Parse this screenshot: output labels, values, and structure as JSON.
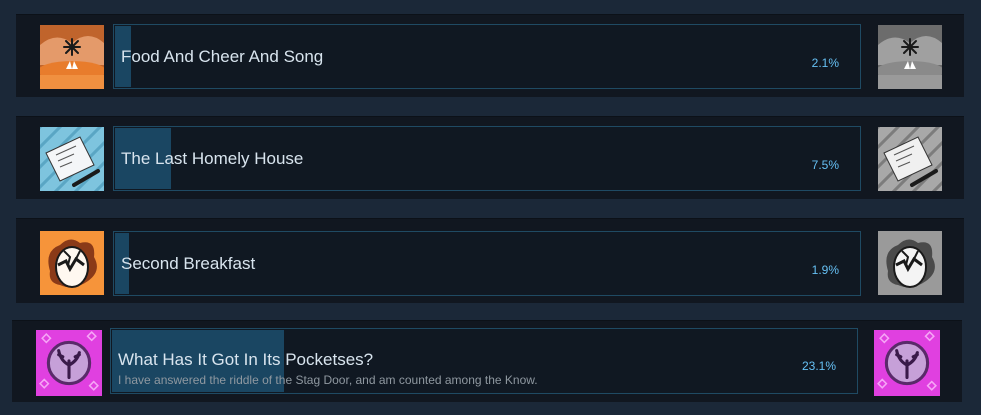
{
  "achievements": [
    {
      "name": "Food And Cheer And Song",
      "description": "",
      "percent_label": "2.1%",
      "percent": 2.1,
      "icon": "feast-plate-icon"
    },
    {
      "name": "The Last Homely House",
      "description": "",
      "percent_label": "7.5%",
      "percent": 7.5,
      "icon": "letter-and-pen-icon"
    },
    {
      "name": "Second Breakfast",
      "description": "",
      "percent_label": "1.9%",
      "percent": 1.9,
      "icon": "cracked-egg-icon"
    },
    {
      "name": "What Has It Got In Its Pocketses?",
      "description": "I have answered the riddle of the Stag Door, and am counted among the Know.",
      "percent_label": "23.1%",
      "percent": 23.1,
      "icon": "stag-antler-icon"
    }
  ]
}
